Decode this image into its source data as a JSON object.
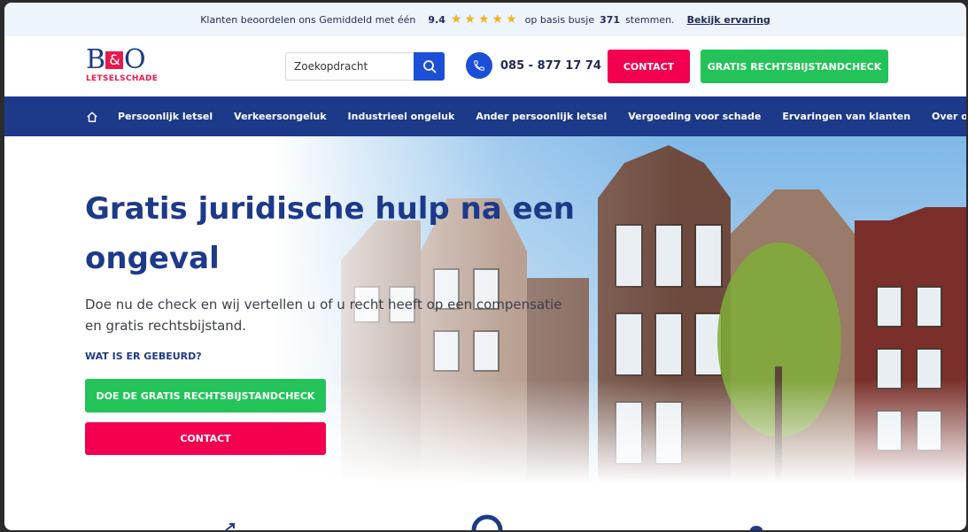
{
  "topbar": {
    "text": "Klanten beoordelen ons Gemiddeld met één",
    "score": "9.4",
    "stars": "★★★★★",
    "basis": "op basis busje",
    "count": "371",
    "votes": "stemmen.",
    "link": "Bekijk ervaring"
  },
  "logo": {
    "left": "B",
    "amp": "&",
    "right": "O",
    "sub": "LETSELSCHADE"
  },
  "search": {
    "placeholder": "Zoekopdracht",
    "icon": "search-icon"
  },
  "phone": {
    "number": "085 - 877 17 74",
    "icon": "phone-icon"
  },
  "header_buttons": {
    "contact": "CONTACT",
    "check": "GRATIS RECHTSBIJSTANDCHECK"
  },
  "nav": {
    "home_icon": "home-icon",
    "items": [
      "Persoonlijk letsel",
      "Verkeersongeluk",
      "Industrieel ongeluk",
      "Ander persoonlijk letsel",
      "Vergoeding voor schade",
      "Ervaringen van klanten",
      "Over ons"
    ]
  },
  "hero": {
    "title": "Gratis juridische hulp na een ongeval",
    "lead": "Doe nu de check en wij vertellen u of u recht heeft op een compensatie en gratis rechtsbijstand.",
    "question": "WAT IS ER GEBEURD?",
    "cta_check": "DOE DE GRATIS RECHTSBIJSTANDCHECK",
    "cta_contact": "CONTACT"
  },
  "colors": {
    "brand_blue": "#1d3a8a",
    "accent_blue": "#1b4fd8",
    "red": "#f2004f",
    "green": "#23c35a",
    "star": "#f2b31a"
  }
}
